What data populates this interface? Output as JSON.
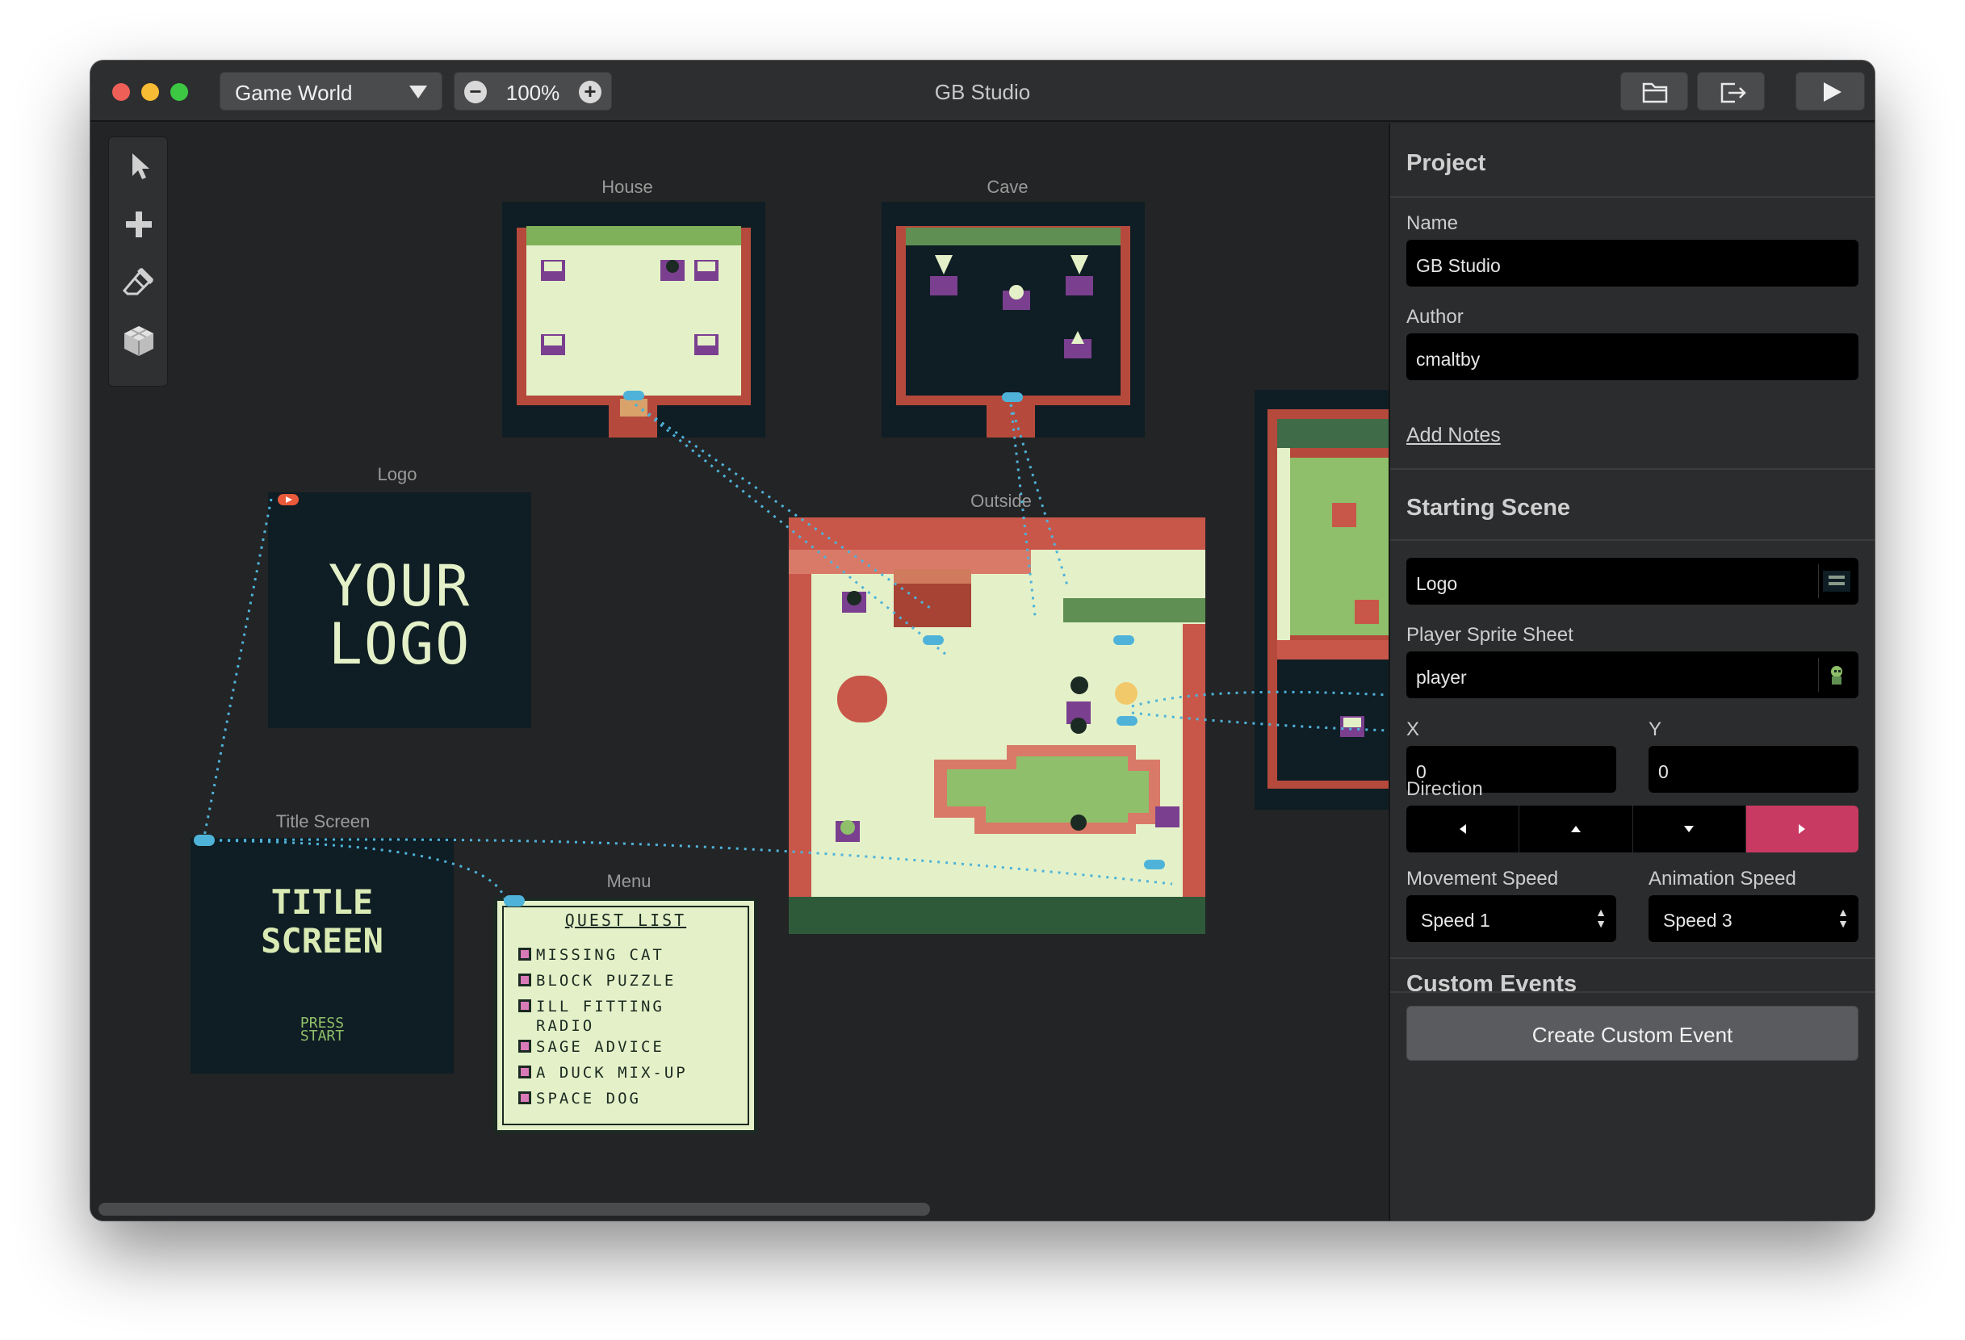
{
  "window": {
    "title": "GB Studio",
    "world_select": "Game World",
    "zoom": "100%",
    "zoom_out_icon": "minus-icon",
    "zoom_in_icon": "plus-icon"
  },
  "tools": [
    {
      "name": "select-tool",
      "icon": "cursor-icon"
    },
    {
      "name": "add-tool",
      "icon": "plus-icon"
    },
    {
      "name": "eraser-tool",
      "icon": "eraser-icon"
    },
    {
      "name": "collision-tool",
      "icon": "cube-icon"
    }
  ],
  "scenes": {
    "house": "House",
    "cave": "Cave",
    "logo": "Logo",
    "outside": "Outside",
    "title_screen": "Title Screen",
    "menu": "Menu"
  },
  "logo_art": {
    "line1": "YOUR",
    "line2": "LOGO"
  },
  "title_art": {
    "line1": "TITLE",
    "line2": "SCREEN",
    "press": "PRESS",
    "start": "START"
  },
  "menu_art": {
    "heading": "QUEST LIST",
    "items": [
      "MISSING CAT",
      "BLOCK PUZZLE",
      "ILL FITTING",
      "RADIO",
      "SAGE ADVICE",
      "A DUCK MIX-UP",
      "SPACE DOG"
    ]
  },
  "sidebar": {
    "project_title": "Project",
    "name_label": "Name",
    "name_value": "GB Studio",
    "author_label": "Author",
    "author_value": "cmaltby",
    "add_notes": "Add Notes",
    "starting_scene_title": "Starting Scene",
    "starting_scene_value": "Logo",
    "sprite_label": "Player Sprite Sheet",
    "sprite_value": "player",
    "x_label": "X",
    "x_value": "0",
    "y_label": "Y",
    "y_value": "0",
    "direction_label": "Direction",
    "direction_selected": "right",
    "movement_label": "Movement Speed",
    "movement_value": "Speed 1",
    "animation_label": "Animation Speed",
    "animation_value": "Speed 3",
    "custom_events_title": "Custom Events",
    "create_event": "Create Custom Event"
  },
  "colors": {
    "accent": "#c93a62",
    "link": "#4fb3d9",
    "gb_light": "#e4f1c8",
    "gb_green": "#8fbf6a",
    "gb_red": "#c8574a"
  }
}
